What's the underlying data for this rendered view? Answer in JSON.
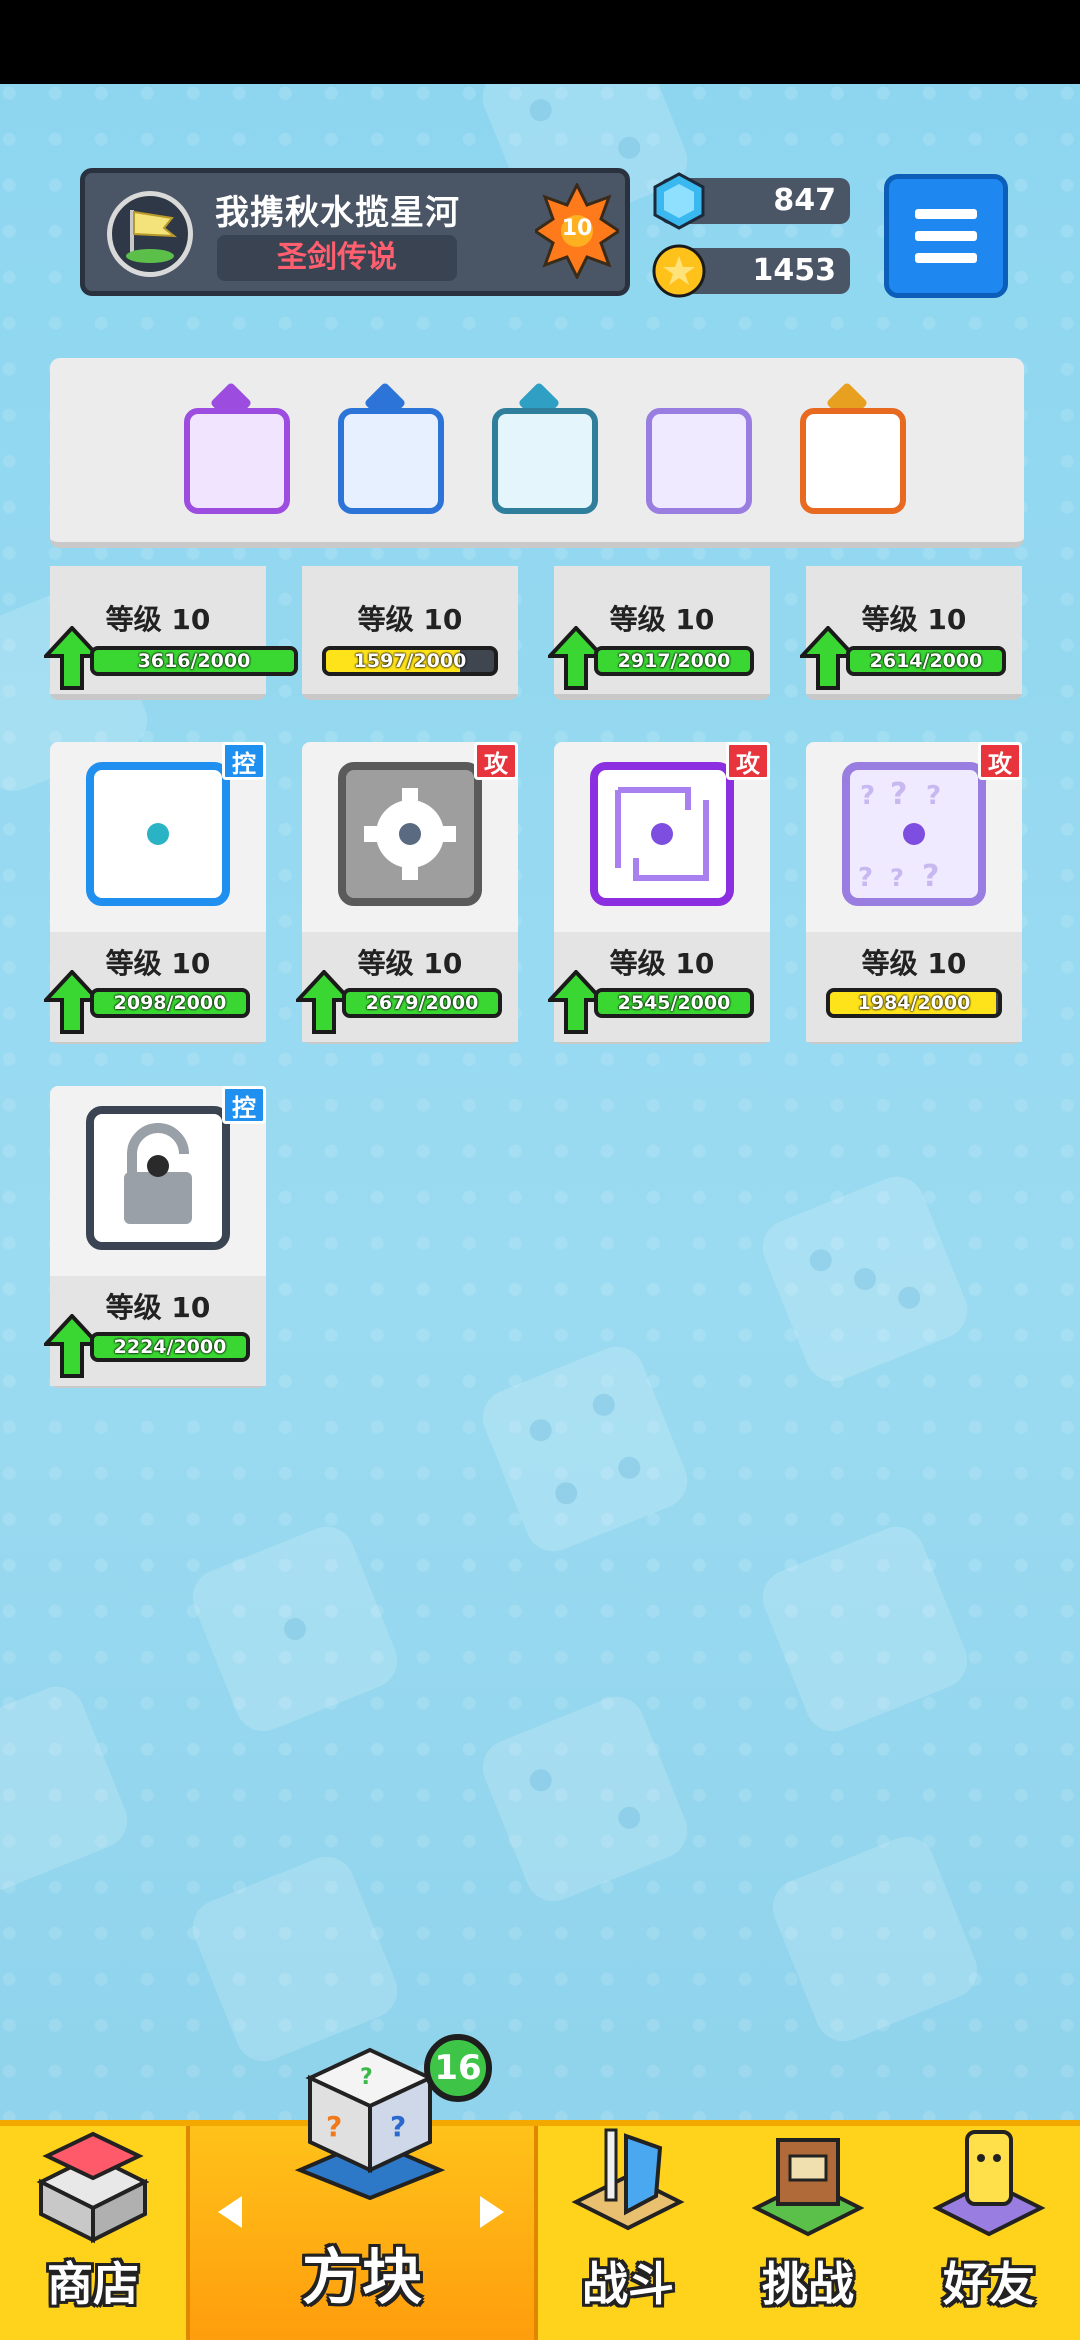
{
  "header": {
    "player_name": "我携秋水揽星河",
    "player_title": "圣剑传说",
    "rank_level": "10",
    "gems": "847",
    "gold": "1453"
  },
  "deck": {
    "slots": [
      {
        "icon": "galaxy-dice-icon",
        "color": "#9c4ddf"
      },
      {
        "icon": "snowflake-dice-icon",
        "color": "#2d74d9"
      },
      {
        "icon": "whirlwind-dice-icon",
        "color": "#2f9fc4"
      },
      {
        "icon": "mystery-dice-icon",
        "color": "#9a7de0"
      },
      {
        "icon": "infinity-dice-icon",
        "color": "#e8a020"
      }
    ]
  },
  "cards_partial_row": [
    {
      "level": "等级  10",
      "progress": "3616/2000",
      "progress_fraction": 1.0,
      "upgradable": true
    },
    {
      "level": "等级  10",
      "progress": "1597/2000",
      "progress_fraction": 0.8,
      "upgradable": false
    },
    {
      "level": "等级  10",
      "progress": "2917/2000",
      "progress_fraction": 1.0,
      "upgradable": true
    },
    {
      "level": "等级  10",
      "progress": "2614/2000",
      "progress_fraction": 1.0,
      "upgradable": true
    }
  ],
  "cards": [
    {
      "name": "ice-dice",
      "tag": "控",
      "tag_type": "ctrl",
      "level": "等级  10",
      "progress": "2098/2000",
      "progress_fraction": 1.0,
      "upgradable": true
    },
    {
      "name": "gear-dice",
      "tag": "攻",
      "tag_type": "atk",
      "level": "等级  10",
      "progress": "2679/2000",
      "progress_fraction": 1.0,
      "upgradable": true
    },
    {
      "name": "cycle-dice",
      "tag": "攻",
      "tag_type": "atk",
      "level": "等级  10",
      "progress": "2545/2000",
      "progress_fraction": 1.0,
      "upgradable": true
    },
    {
      "name": "mystery-dice",
      "tag": "攻",
      "tag_type": "atk",
      "level": "等级  10",
      "progress": "1984/2000",
      "progress_fraction": 0.99,
      "upgradable": false
    },
    {
      "name": "lock-dice",
      "tag": "控",
      "tag_type": "ctrl",
      "level": "等级  10",
      "progress": "2224/2000",
      "progress_fraction": 1.0,
      "upgradable": true
    }
  ],
  "nav": {
    "shop": "商店",
    "dice": "方块",
    "battle": "战斗",
    "challenge": "挑战",
    "friends": "好友",
    "dice_badge": "16"
  },
  "colors": {
    "upgrade_green": "#3ad632",
    "partial_yellow": "#ffe31a",
    "ctrl_blue": "#1f8ff0",
    "atk_red": "#e8343c",
    "nav_yellow": "#ffd21c"
  }
}
